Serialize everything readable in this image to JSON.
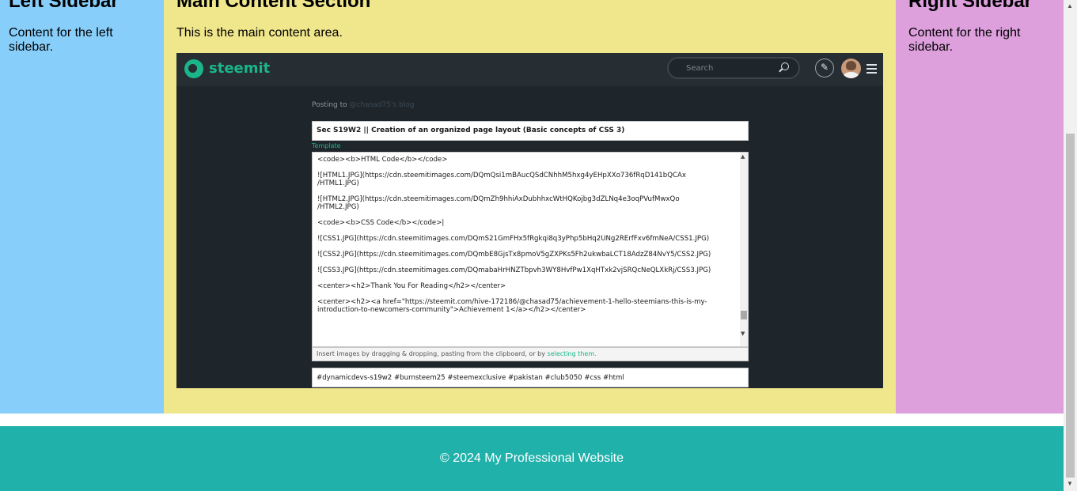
{
  "left_sidebar": {
    "title": "Left Sidebar",
    "text": "Content for the left sidebar."
  },
  "main": {
    "title": "Main Content Section",
    "text": "This is the main content area."
  },
  "right_sidebar": {
    "title": "Right Sidebar",
    "text": "Content for the right sidebar."
  },
  "footer": {
    "text": "© 2024 My Professional Website"
  },
  "colors": {
    "left_sidebar_bg": "#87cefa",
    "main_bg": "#f0e68c",
    "right_sidebar_bg": "#dda0dd",
    "footer_bg": "#20b2aa",
    "steemit_accent": "#1ab68a"
  },
  "screenshot": {
    "logo": "steemit",
    "search_placeholder": "Search",
    "icons": [
      "steemit-logo-icon",
      "search-icon",
      "pencil-icon",
      "avatar",
      "menu-icon"
    ],
    "posting_prefix": "Posting to",
    "posting_target": "@chasad75's blog",
    "post_title": "Sec S19W2 || Creation of an organized page layout (Basic concepts of CSS 3)",
    "template_label": "Template",
    "editor_lines": [
      "<code><b>HTML Code</b></code>",
      "",
      "![HTML1.JPG](https://cdn.steemitimages.com/DQmQsi1mBAucQSdCNhhM5hxg4yEHpXXo736fRqD141bQCAx",
      "/HTML1.JPG)",
      "",
      "![HTML2.JPG](https://cdn.steemitimages.com/DQmZh9hhiAxDubhhxcWtHQKojbg3dZLNq4e3oqPVufMwxQo",
      "/HTML2.JPG)",
      "",
      "<code><b>CSS Code</b></code>|",
      "",
      "![CSS1.JPG](https://cdn.steemitimages.com/DQmS21GmFHx5fRgkqi8q3yPhp5bHq2UNg2RErfFxv6fmNeA/CSS1.JPG)",
      "",
      "![CSS2.JPG](https://cdn.steemitimages.com/DQmbE8GjsTx8pmoV5gZXPKs5Fh2ukwbaLCT18AdzZ84NvY5/CSS2.JPG)",
      "",
      "![CSS3.JPG](https://cdn.steemitimages.com/DQmabaHrHNZTbpvh3WY8HvfPw1XqHTxk2vjSRQcNeQLXkRj/CSS3.JPG)",
      "",
      "<center><h2>Thank You For Reading</h2></center>",
      "",
      "<center><h2><a href=\"https://steemit.com/hive-172186/@chasad75/achievement-1-hello-steemians-this-is-my-",
      "introduction-to-newcomers-community\">Achievement 1</a></h2></center>"
    ],
    "hint_prefix": "Insert images by dragging & dropping, pasting from the clipboard, or by",
    "hint_link": "selecting them.",
    "tags": "#dynamicdevs-s19w2 #burnsteem25 #steemexclusive #pakistan #club5050 #css #html"
  }
}
